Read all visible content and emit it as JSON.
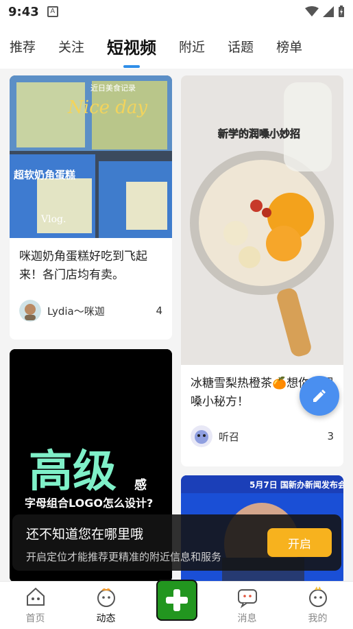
{
  "status_bar": {
    "time": "9:43",
    "notif_icon": "A"
  },
  "tabs": [
    {
      "label": "推荐"
    },
    {
      "label": "关注"
    },
    {
      "label": "短视频",
      "active": true
    },
    {
      "label": "附近"
    },
    {
      "label": "话题"
    },
    {
      "label": "榜单"
    }
  ],
  "cards": [
    {
      "image_text": {
        "top": "近日美食记录",
        "script": "Nice day",
        "corner": "Vlog.",
        "box_label": "超软奶角蛋糕"
      },
      "caption": "咪迦奶角蛋糕好吃到飞起来！各门店均有卖。",
      "author": "Lydia～咪迦",
      "likes": "4"
    },
    {
      "image_text": {
        "title": "新学的润嗓小妙招"
      },
      "caption": "冰糖雪梨热橙茶🍊想你的润嗓小秘方！",
      "author": "听召",
      "likes": "3"
    },
    {
      "image_text": {
        "big": "高级",
        "small": "感",
        "sub": "字母组合LOGO怎么设计?"
      }
    },
    {
      "image_text": {
        "headline": "5月7日 国新办新闻发布会"
      }
    }
  ],
  "toast": {
    "title": "还不知道您在哪里哦",
    "subtitle": "开启定位才能推荐更精准的附近信息和服务",
    "button": "开启"
  },
  "bottom_nav": [
    {
      "label": "首页",
      "icon": "home-icon"
    },
    {
      "label": "动态",
      "icon": "feed-icon",
      "active": true
    },
    {
      "label": "",
      "icon": "plus-icon"
    },
    {
      "label": "消息",
      "icon": "message-icon"
    },
    {
      "label": "我的",
      "icon": "profile-icon"
    }
  ],
  "colors": {
    "accent": "#2f8ee8",
    "fab": "#4a8ff0",
    "toast_button": "#f7b21e",
    "plus": "#22961f"
  }
}
